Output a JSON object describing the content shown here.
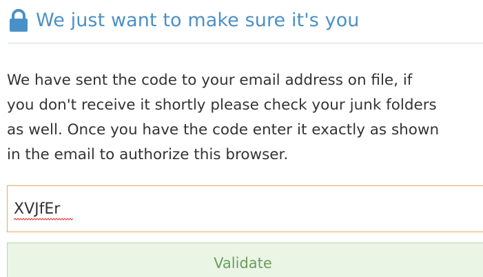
{
  "header": {
    "icon": "lock-icon",
    "title": "We just want to make sure it's you"
  },
  "message": {
    "lines": [
      "We have sent the code to your email address on file, if",
      "you don't receive it shortly please check your junk folders",
      "as well. Once you have the code enter it exactly as shown",
      "in the email to authorize this browser."
    ]
  },
  "code_input": {
    "value": "XVJfEr"
  },
  "validate_button": {
    "label": "Validate"
  },
  "colors": {
    "title": "#4a90c8",
    "input_border": "#f0a35a",
    "button_bg": "#eaf5e6",
    "button_border": "#b5d8a8",
    "button_text": "#6a9e5a"
  }
}
